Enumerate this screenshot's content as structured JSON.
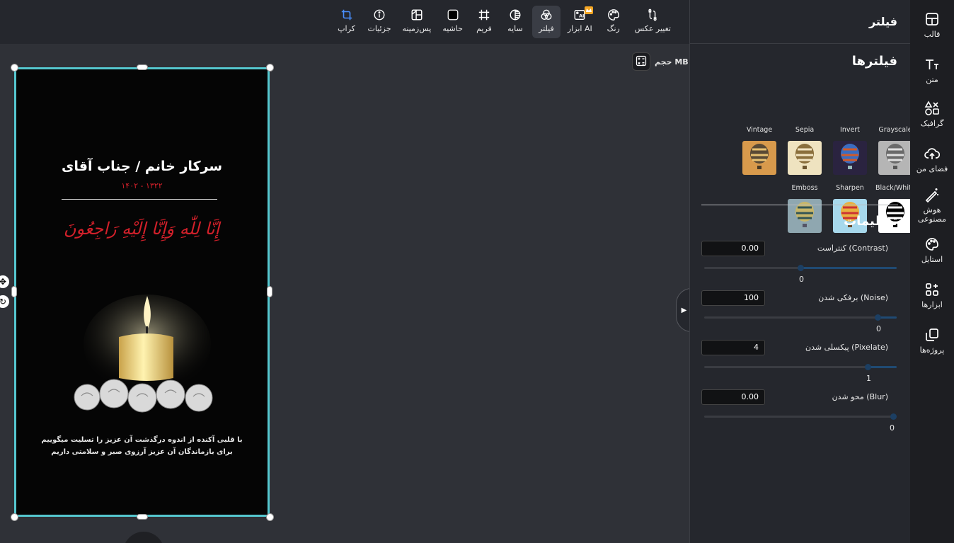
{
  "toolbar": {
    "tools": [
      {
        "id": "change-photo",
        "label": "تغییر عکس",
        "icon": "swap-image-icon"
      },
      {
        "id": "color",
        "label": "رنگ",
        "icon": "palette-icon"
      },
      {
        "id": "ai-tools",
        "label": "ابزار AI",
        "icon": "ai-image-icon"
      },
      {
        "id": "filter",
        "label": "فیلتر",
        "icon": "filter-circles-icon",
        "active": true
      },
      {
        "id": "shadow",
        "label": "سایه",
        "icon": "shadow-icon"
      },
      {
        "id": "frame",
        "label": "فریم",
        "icon": "frame-grid-icon"
      },
      {
        "id": "border",
        "label": "حاشیه",
        "icon": "border-square-icon"
      },
      {
        "id": "background",
        "label": "پس‌زمینه",
        "icon": "background-layout-icon"
      },
      {
        "id": "details",
        "label": "جزئیات",
        "icon": "info-icon"
      },
      {
        "id": "crop",
        "label": "کراپ",
        "icon": "crop-icon"
      }
    ]
  },
  "canvas": {
    "size_label": "حجم MB"
  },
  "poster": {
    "title": "سرکار خانم / جناب آقای",
    "years": "۱۴۰۲ - ۱۳۲۲",
    "verse": "إِنَّا لِلّٰهِ وَإِنَّا إِلَيْهِ رَاجِعُونَ",
    "message_line1": "با قلبی آکنده از اندوه درگذشت آن عزیز را تسلیت میگوییم",
    "message_line2": "برای بازماندگان آن عزیز آرزوی صبر و سلامتی داریم"
  },
  "panel": {
    "header": "فیلتر",
    "filters_title": "فیلترها",
    "filters": [
      {
        "label": "Grayscale"
      },
      {
        "label": "Invert"
      },
      {
        "label": "Sepia"
      },
      {
        "label": "Vintage"
      },
      {
        "label": "Black/White"
      },
      {
        "label": "Sharpen"
      },
      {
        "label": "Emboss"
      }
    ],
    "settings_title": "تنظیمات",
    "settings": [
      {
        "name": "کنتراست (Contrast)",
        "field": "0.00",
        "value": "0",
        "fraction": 0.5
      },
      {
        "name": "برفکی شدن (Noise)",
        "field": "100",
        "value": "0",
        "fraction": 0.9
      },
      {
        "name": "پیکسلی شدن (Pixelate)",
        "field": "4",
        "value": "1",
        "fraction": 0.85
      },
      {
        "name": "محو شدن (Blur)",
        "field": "0.00",
        "value": "0",
        "fraction": 1.0
      }
    ]
  },
  "nav": {
    "items": [
      {
        "label": "قالب",
        "icon": "template-layout-icon"
      },
      {
        "label": "متن",
        "icon": "text-icon"
      },
      {
        "label": "گرافیک",
        "icon": "shapes-icon"
      },
      {
        "label": "فضای من",
        "icon": "cloud-upload-icon"
      },
      {
        "label": "هوش مصنوعی",
        "icon": "magic-wand-icon"
      },
      {
        "label": "استایل",
        "icon": "palette-icon"
      },
      {
        "label": "ابزارها",
        "icon": "apps-plus-icon"
      },
      {
        "label": "پروژه‌ها",
        "icon": "copy-pages-icon"
      }
    ]
  },
  "colors": {
    "selection": "#55c7cf",
    "years_red": "#d2202a",
    "slider_fill": "#1f4a73",
    "crop_blue": "#4a90ff",
    "crown": "#f5a623"
  }
}
